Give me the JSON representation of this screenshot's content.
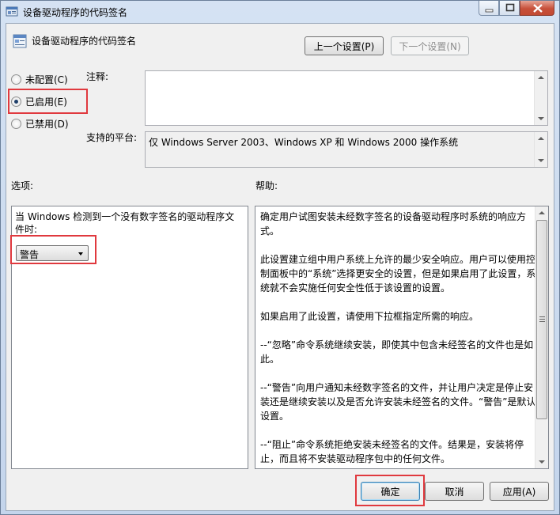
{
  "window": {
    "title": "设备驱动程序的代码签名",
    "controls": [
      "minimize-icon",
      "maximize-icon",
      "close-icon"
    ]
  },
  "header": {
    "policy_title": "设备驱动程序的代码签名",
    "prev_button": "上一个设置(P)",
    "next_button": "下一个设置(N)"
  },
  "state": {
    "options": [
      {
        "label": "未配置(C)",
        "checked": false
      },
      {
        "label": "已启用(E)",
        "checked": true
      },
      {
        "label": "已禁用(D)",
        "checked": false
      }
    ]
  },
  "comment": {
    "label": "注释:",
    "value": ""
  },
  "platform": {
    "label": "支持的平台:",
    "value": "仅 Windows Server 2003、Windows XP 和 Windows 2000 操作系统"
  },
  "options_section": {
    "label": "选项:",
    "description": "当 Windows 检测到一个没有数字签名的驱动程序文件时:",
    "combo_value": "警告"
  },
  "help_section": {
    "label": "帮助:",
    "paragraphs": [
      "确定用户试图安装未经数字签名的设备驱动程序时系统的响应方式。",
      "此设置建立组中用户系统上允许的最少安全响应。用户可以使用控制面板中的“系统”选择更安全的设置，但是如果启用了此设置，系统就不会实施任何安全性低于该设置的设置。",
      "如果启用了此设置，请使用下拉框指定所需的响应。",
      "--“忽略”命令系统继续安装，即使其中包含未经签名的文件也是如此。",
      "--“警告”向用户通知未经数字签名的文件，并让用户决定是停止安装还是继续安装以及是否允许安装未经签名的文件。“警告”是默认设置。",
      "--“阻止”命令系统拒绝安装未经签名的文件。结果是，安装将停止，而且将不安装驱动程序包中的任何文件。"
    ]
  },
  "footer": {
    "ok_button": "确定",
    "cancel_button": "取消",
    "apply_button": "应用(A)"
  },
  "colors": {
    "highlight": "#e0393e",
    "title_gradient_top": "#d5e2f3",
    "client_bg": "#f0f0f0"
  }
}
